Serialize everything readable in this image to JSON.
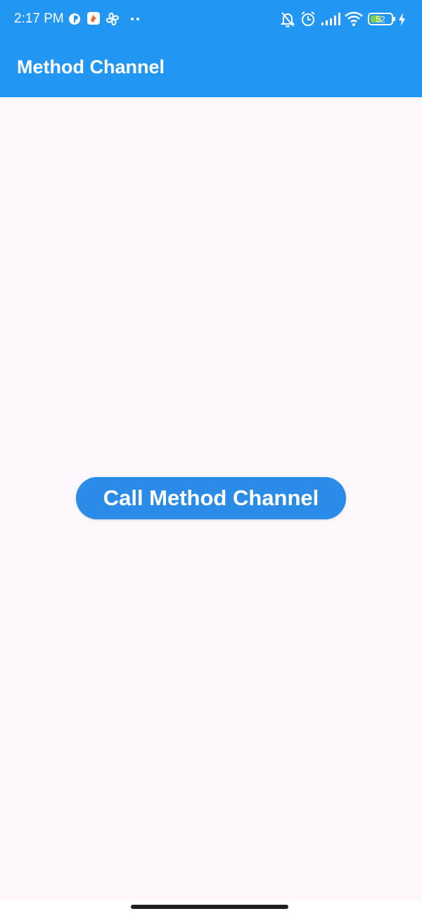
{
  "status_bar": {
    "time": "2:17 PM",
    "battery_level": "52",
    "icons": {
      "left": [
        "pinterest-like-icon",
        "app-notification-icon",
        "fan-icon",
        "more-dots-icon"
      ],
      "right": [
        "muted-bell-icon",
        "alarm-icon",
        "signal-icon",
        "wifi-icon",
        "battery-icon",
        "charging-icon"
      ]
    },
    "colors": {
      "background": "#2196f3",
      "foreground": "#ffffff",
      "app_icon_orange": "#f06a2a",
      "battery_fill": "#7cd151"
    }
  },
  "app_bar": {
    "title": "Method Channel",
    "color": "#2196f3"
  },
  "main": {
    "call_button_label": "Call Method Channel",
    "button_color": "#2b8ce8",
    "background_color": "#fdf7fc"
  }
}
